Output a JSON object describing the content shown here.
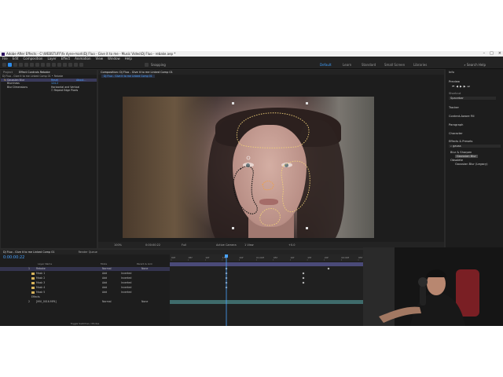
{
  "window": {
    "title": "Adobe After Effects - C:\\WEBSTUFF\\fx dyne-mark\\Dj Fluo - Give it to me - Music Video\\Dj Fluo - rebake.aep *"
  },
  "menu": [
    "File",
    "Edit",
    "Composition",
    "Layer",
    "Effect",
    "Animation",
    "View",
    "Window",
    "Help"
  ],
  "toolbar": {
    "snapping_label": "Snapping",
    "workspaces": [
      "Default",
      "Learn",
      "Standard",
      "Small Screen",
      "Libraries"
    ],
    "search_help": "Search Help"
  },
  "project_panel": {
    "tabs": [
      "Project",
      "Effect Controls Rebake"
    ],
    "header": "Dj Fluo - Give it to me Linked Comp 01 • Rebake",
    "effect_name": "Gaussian Blur",
    "reset_label": "Reset",
    "about_label": "About...",
    "rows": [
      {
        "label": "Blurriness",
        "value": "124.2"
      },
      {
        "label": "Blur Dimensions",
        "value": "Horizontal and Vertical"
      },
      {
        "label": "",
        "value": "Repeat Edge Pixels"
      }
    ]
  },
  "composition": {
    "tab": "Composition: Dj Fluo - Give it to me Linked Comp 01",
    "sub_tab": "Dj Fluo - Give it to me Linked Comp 01",
    "viewer_bar": {
      "zoom": "100%",
      "timecode": "0:00:00:22",
      "resolution": "Full",
      "camera": "Active Camera",
      "views": "1 View",
      "offset": "+0.0"
    }
  },
  "right_panel": {
    "info": "Info",
    "preview": "Preview",
    "shortcut_label": "Shortcut",
    "shortcut_value": "Spacebar",
    "sections": [
      "Tracker",
      "Content-Aware Fill",
      "Paragraph",
      "Character"
    ],
    "effects_presets": "Effects & Presets",
    "search_value": "gauss",
    "tree": [
      "Blur & Sharpen",
      "Gaussian Blur",
      "Obsolete",
      "Gaussian Blur (Legacy)"
    ]
  },
  "timeline": {
    "tabs": [
      "Dj Fluo - Give it to me Linked Comp 01",
      "Render Queue"
    ],
    "timecode": "0:00:00:22",
    "ruler": [
      "00f",
      "05f",
      "10f",
      "15f",
      "20f",
      "01:00f",
      "05f",
      "10f",
      "15f",
      "20f",
      "02:00f",
      "05f"
    ],
    "columns": [
      "Layer Name",
      "Mode",
      "Parent & Link"
    ],
    "layers": [
      {
        "num": "1",
        "name": "Rebake",
        "mode": "Normal",
        "parent": "None",
        "selected": true
      },
      {
        "num": "",
        "name": "Mask 1",
        "mode": "Add",
        "parent": "Inverted",
        "selected": false
      },
      {
        "num": "",
        "name": "Mask 2",
        "mode": "Add",
        "parent": "Inverted",
        "selected": false
      },
      {
        "num": "",
        "name": "Mask 3",
        "mode": "Add",
        "parent": "Inverted",
        "selected": false
      },
      {
        "num": "",
        "name": "Mask 4",
        "mode": "Add",
        "parent": "Inverted",
        "selected": false
      },
      {
        "num": "",
        "name": "Mask 5",
        "mode": "Add",
        "parent": "Inverted",
        "selected": false
      },
      {
        "num": "",
        "name": "Effects",
        "mode": "",
        "parent": "",
        "selected": false
      },
      {
        "num": "2",
        "name": "[MVI_0016.MP4]",
        "mode": "Normal",
        "parent": "None",
        "selected": false
      }
    ],
    "footer": "Toggle Switches / Modes"
  },
  "colors": {
    "accent": "#2d8ceb",
    "mask_outline": "#f2d27a",
    "playhead": "#4aa3ff"
  }
}
